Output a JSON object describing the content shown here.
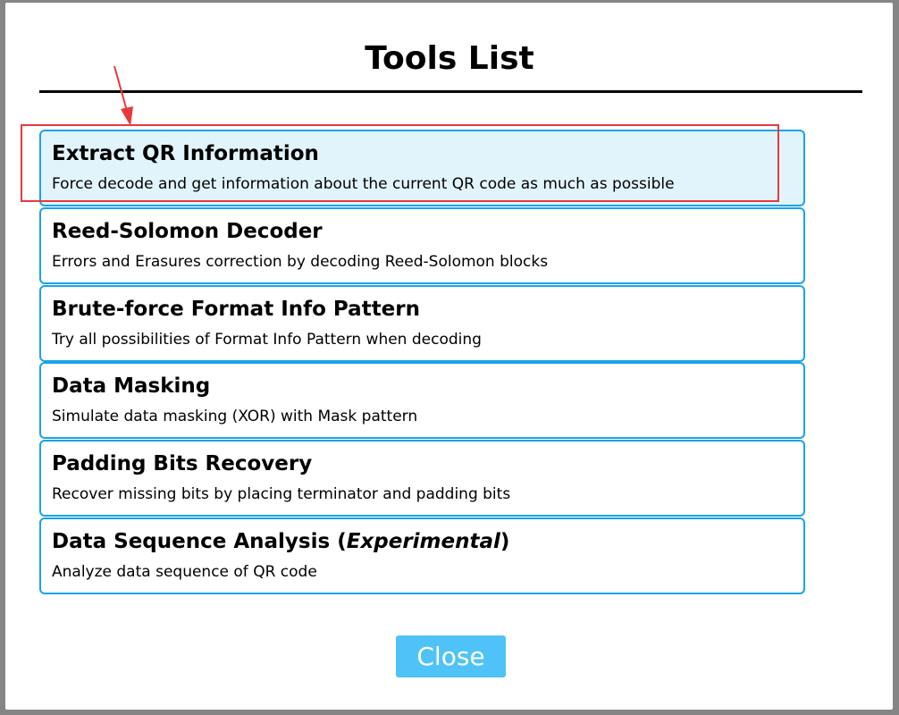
{
  "dialog": {
    "title": "Tools List",
    "close_label": "Close"
  },
  "tools": [
    {
      "name": "Extract QR Information",
      "description": "Force decode and get information about the current QR code as much as possible",
      "active": true
    },
    {
      "name": "Reed-Solomon Decoder",
      "description": "Errors and Erasures correction by decoding Reed-Solomon blocks",
      "active": false
    },
    {
      "name": "Brute-force Format Info Pattern",
      "description": "Try all possibilities of Format Info Pattern when decoding",
      "active": false
    },
    {
      "name": "Data Masking",
      "description": "Simulate data masking (XOR) with Mask pattern",
      "active": false
    },
    {
      "name": "Padding Bits Recovery",
      "description": "Recover missing bits by placing terminator and padding bits",
      "active": false
    },
    {
      "name": "Data Sequence Analysis (",
      "name_emphasis": "Experimental",
      "name_suffix": ")",
      "description": "Analyze data sequence of QR code",
      "active": false
    }
  ],
  "colors": {
    "border": "#1aa3e8",
    "active_background": "#e1f4fc",
    "highlight": "#e8383d",
    "close_button": "#4fc3f7",
    "backdrop": "#858585"
  },
  "annotations": {
    "highlight_target": "Extract QR Information",
    "arrow_icon": "red-arrow-icon"
  }
}
